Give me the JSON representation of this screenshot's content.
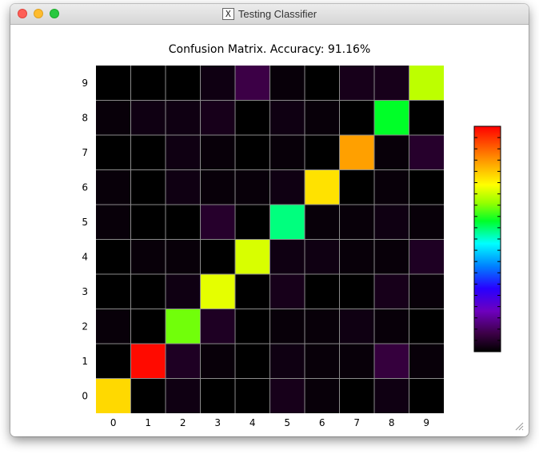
{
  "window": {
    "title": "Testing Classifier",
    "x11_icon": "x11-icon"
  },
  "chart_data": {
    "type": "heatmap",
    "title": "Confusion Matrix. Accuracy: 91.16%",
    "xlabel": "",
    "ylabel": "",
    "x_ticks": [
      "0",
      "1",
      "2",
      "3",
      "4",
      "5",
      "6",
      "7",
      "8",
      "9"
    ],
    "y_ticks": [
      "0",
      "1",
      "2",
      "3",
      "4",
      "5",
      "6",
      "7",
      "8",
      "9"
    ],
    "colormap": "gist_rainbow_r (black→purple→blue→cyan→green→yellow→orange→red)",
    "vlim": [
      0,
      1
    ],
    "grid": true,
    "colorbar": "right",
    "matrix": [
      [
        0.78,
        0.0,
        0.02,
        0.0,
        0.0,
        0.03,
        0.01,
        0.0,
        0.02,
        0.0
      ],
      [
        0.0,
        0.99,
        0.04,
        0.01,
        0.0,
        0.02,
        0.01,
        0.01,
        0.07,
        0.01
      ],
      [
        0.01,
        0.0,
        0.64,
        0.04,
        0.0,
        0.01,
        0.01,
        0.02,
        0.01,
        0.0
      ],
      [
        0.0,
        0.0,
        0.02,
        0.72,
        0.0,
        0.03,
        0.0,
        0.0,
        0.03,
        0.01
      ],
      [
        0.0,
        0.01,
        0.01,
        0.0,
        0.71,
        0.02,
        0.02,
        0.01,
        0.01,
        0.04
      ],
      [
        0.01,
        0.0,
        0.0,
        0.05,
        0.0,
        0.54,
        0.01,
        0.01,
        0.02,
        0.01
      ],
      [
        0.01,
        0.0,
        0.02,
        0.01,
        0.01,
        0.02,
        0.77,
        0.0,
        0.01,
        0.0
      ],
      [
        0.0,
        0.0,
        0.02,
        0.01,
        0.0,
        0.01,
        0.0,
        0.84,
        0.01,
        0.05
      ],
      [
        0.01,
        0.02,
        0.02,
        0.03,
        0.0,
        0.02,
        0.01,
        0.0,
        0.58,
        0.0
      ],
      [
        0.0,
        0.0,
        0.0,
        0.02,
        0.08,
        0.01,
        0.0,
        0.03,
        0.03,
        0.69
      ]
    ]
  }
}
